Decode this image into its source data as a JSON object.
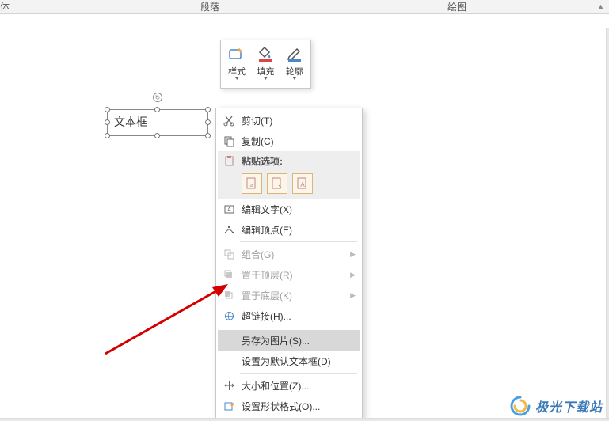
{
  "ribbon": {
    "font": "体",
    "paragraph": "段落",
    "drawing": "绘图"
  },
  "miniToolbar": {
    "style": "样式",
    "fill": "填充",
    "outline": "轮廓"
  },
  "textbox": {
    "text": "文本框"
  },
  "contextMenu": {
    "cut": "剪切(T)",
    "copy": "复制(C)",
    "pasteOptionsHeader": "粘贴选项:",
    "editText": "编辑文字(X)",
    "editPoints": "编辑顶点(E)",
    "group": "组合(G)",
    "bringFront": "置于顶层(R)",
    "sendBack": "置于底层(K)",
    "hyperlink": "超链接(H)...",
    "saveAsPicture": "另存为图片(S)...",
    "setDefaultTextbox": "设置为默认文本框(D)",
    "sizePosition": "大小和位置(Z)...",
    "formatShape": "设置形状格式(O)..."
  },
  "watermark": "极光下载站"
}
